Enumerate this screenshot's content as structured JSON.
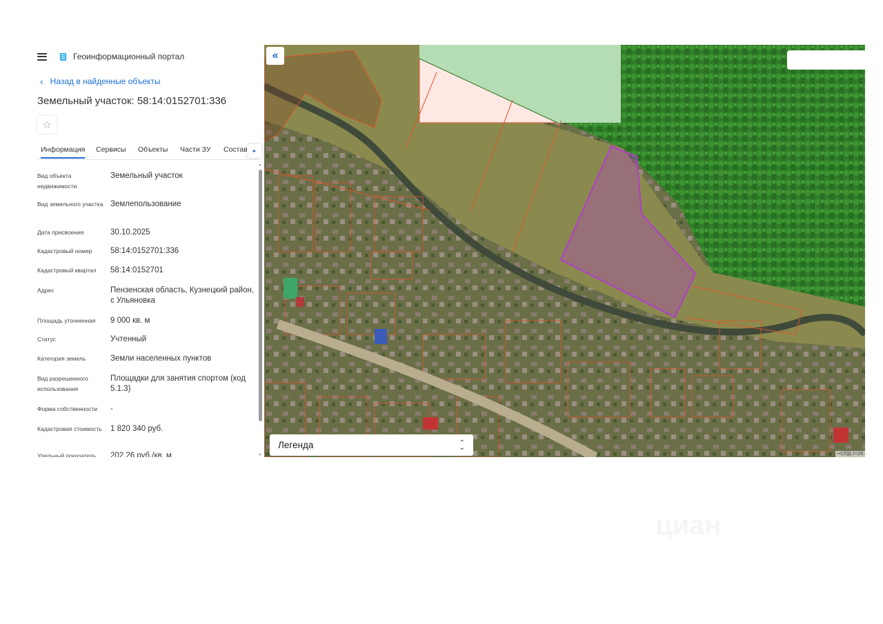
{
  "header": {
    "portal_title": "Геоинформационный портал"
  },
  "nav": {
    "back_label": "Назад в найденные объекты"
  },
  "page": {
    "title": "Земельный участок: 58:14:0152701:336",
    "star": "☆"
  },
  "tabs": [
    {
      "label": "Информация",
      "active": true
    },
    {
      "label": "Сервисы"
    },
    {
      "label": "Объекты"
    },
    {
      "label": "Части ЗУ"
    },
    {
      "label": "Состав"
    }
  ],
  "tab_next": "►",
  "info_rows": [
    {
      "label": "Вид объекта недвижимости",
      "value": "Земельный участок"
    },
    {
      "label": "Вид земельного участка",
      "value": "Землепользование"
    },
    {
      "label": "Дата присвоения",
      "value": "30.10.2025"
    },
    {
      "label": "Кадастровый номер",
      "value": "58:14:0152701:336"
    },
    {
      "label": "Кадастровый квартал",
      "value": "58:14:0152701"
    },
    {
      "label": "Адрес",
      "value": "Пензенская область, Кузнецкий район, с Ульяновка"
    },
    {
      "label": "Площадь уточненная",
      "value": "9 000 кв. м"
    },
    {
      "label": "Статус",
      "value": "Учтенный"
    },
    {
      "label": "Категория земель",
      "value": "Земли населенных пунктов"
    },
    {
      "label": "Вид разрешенного использования",
      "value": "Площадки для занятия спортом (код 5.1.3)"
    },
    {
      "label": "Форма собственности",
      "value": "-"
    },
    {
      "label": "Кадастровая стоимость",
      "value": "1 820 340 руб."
    },
    {
      "label": "Удельный показатель",
      "value": "202,26 руб./кв. м"
    }
  ],
  "map": {
    "collapse_icon": "«",
    "legend_label": "Легенда",
    "legend_toggle": "⌃⌄",
    "copyright": "НСПД 2026",
    "colors": {
      "selected_parcel": "#b03ec8",
      "parcel_border": "#e0552a",
      "forest_zone": "#b4ddb4",
      "link": "#1a6fd4"
    }
  },
  "watermark": "циан"
}
